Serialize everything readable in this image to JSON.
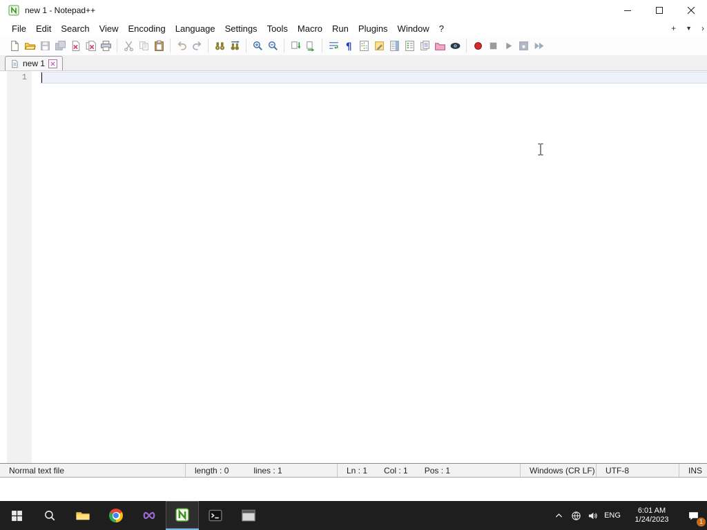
{
  "window": {
    "title": "new 1 - Notepad++"
  },
  "menubar": {
    "items": [
      "File",
      "Edit",
      "Search",
      "View",
      "Encoding",
      "Language",
      "Settings",
      "Tools",
      "Macro",
      "Run",
      "Plugins",
      "Window",
      "?"
    ],
    "plus": "+",
    "tab_dropdown": "▼",
    "overflow": "›"
  },
  "toolbar": {
    "pilcrow_glyph": "¶",
    "icons": [
      "new-file",
      "open-file",
      "save-file",
      "save-all",
      "close-file",
      "close-all",
      "print",
      "cut",
      "copy",
      "paste",
      "undo",
      "redo",
      "find",
      "replace",
      "zoom-in",
      "zoom-out",
      "sync-vertical-scroll",
      "sync-horizontal-scroll",
      "word-wrap",
      "show-all-characters",
      "show-indent-guide",
      "define-language",
      "document-map",
      "function-list",
      "document-list",
      "folder-as-workspace",
      "monitoring",
      "record-macro",
      "stop-recording",
      "playback-macro",
      "save-macro",
      "run-macro-multiple"
    ]
  },
  "tabbar": {
    "tabs": [
      {
        "label": "new 1"
      }
    ]
  },
  "editor": {
    "line_numbers": [
      "1"
    ],
    "text": ""
  },
  "statusbar": {
    "doc_type": "Normal text file",
    "length": "length : 0",
    "lines": "lines : 1",
    "line": "Ln : 1",
    "column": "Col : 1",
    "position": "Pos : 1",
    "eol_format": "Windows (CR LF)",
    "encoding": "UTF-8",
    "typing_mode": "INS"
  },
  "taskbar": {
    "apps": [
      "start",
      "search",
      "file-explorer",
      "chrome",
      "visual-studio",
      "notepad-plus-plus",
      "command-prompt",
      "app-window"
    ],
    "active_app": "notepad-plus-plus",
    "tray": {
      "language": "ENG",
      "time": "6:01 AM",
      "date": "1/24/2023",
      "notification_count": "1"
    }
  }
}
